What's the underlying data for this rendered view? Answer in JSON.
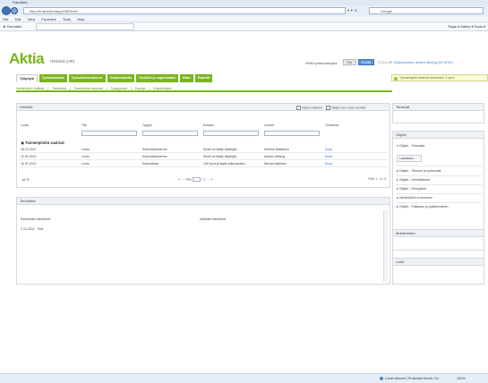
{
  "browser": {
    "window_title": "Favorites",
    "address": "http://hrdesk/hrmapp/HRDesk/",
    "search_placeholder": "Google",
    "menu": [
      "File",
      "Edit",
      "View",
      "Favorites",
      "Tools",
      "Help"
    ],
    "favorites_label": "Favorites",
    "tab_title": "http://hrdesk/hrmapp/HRDesk/",
    "commands": "Page ▾  Safety ▾  Tools ▾",
    "status_zone": "Local intranet | Protected Mode: On",
    "zoom": "100%"
  },
  "app": {
    "logo": "Aktia",
    "subtitle": "HRDesk (HR)",
    "hrm_label": "HRM työskentelytila",
    "lang_fi": "Fin",
    "publish": "Publis",
    "user_text": "Kirjautuneena: Anders Alhsing (0271F20)",
    "user_prefix": "?  |  1.1  |  FI",
    "notice": "Työnantajiltä vaativat henkilöstö: 2 kpl ▸"
  },
  "tabs": [
    "Työpöytä",
    "Työsuhdeasiat",
    "Työsuhdemuutokset",
    "Osaamiskartta",
    "Henkilöt ja organisaatio",
    "Haku",
    "Raportit"
  ],
  "subnav": [
    "Henkilöiden hallinta",
    "|",
    "Tiedotteet",
    "|",
    "Toimittuvien seurant",
    "|",
    "Työpyynnöt",
    "|",
    "Kyselyt",
    "|",
    "Käyttöohjeet"
  ],
  "henkilot": {
    "title": "Henkilöt",
    "check1": "Näytä esitiedot",
    "check2": "Näytä vain omat henkilöt",
    "columns": [
      "Luotu",
      "Tila",
      "Tyyppi",
      "Kuvaus",
      "Luonut",
      "Toiminnot"
    ],
    "group": "Toimenpiteitä vaativat",
    "rows": [
      [
        "28.12.2011",
        "Luotu",
        "Keskustelukierros",
        "Smail on tilatty käyttöjär...",
        "Kristine Mattianen",
        "Avaa"
      ],
      [
        "12.01.2012",
        "Luotu",
        "Keskustelukierros",
        "Smail on tilatty käyttöjär...",
        "Anders Alhsing",
        "Avaa"
      ],
      [
        "16.01.2012",
        "Luotu",
        "Keskuslista",
        "Ole hyvä ja täytä esikuvaukse...",
        "Mervia Mäkinen",
        "Avaa"
      ]
    ],
    "footer_icons": "⇄  ⟳",
    "pager_prev": "⇐  ←  Sivu",
    "pager_next": "/ 1  →  ⇒",
    "count": "Rivit 1 - 3 / 3"
  },
  "tiedotteet": {
    "title": "Tiedotteet",
    "col1": "Esimiesten tiedotteet",
    "col2": "Kaikkien tiedotteet",
    "row_date": "2.12.2011",
    "row_text": "Test"
  },
  "sidebar": {
    "todo_title": "Tehtävät",
    "objects_title": "Objekt",
    "objects": [
      "Objekt - Toiluvaka"
    ],
    "button": "Laatalaan...",
    "objects2": [
      "Objekt - Tiemuut ja työsuodat",
      "Objekt - Henkilötiedot",
      "Objekt - Rensylistit",
      "Henkilöstön erohuomio",
      "Objekt - Palkkaus ja palkkiosriinen"
    ],
    "muistiot_title": "Muistiohatut",
    "linkit_title": "Linkit"
  }
}
